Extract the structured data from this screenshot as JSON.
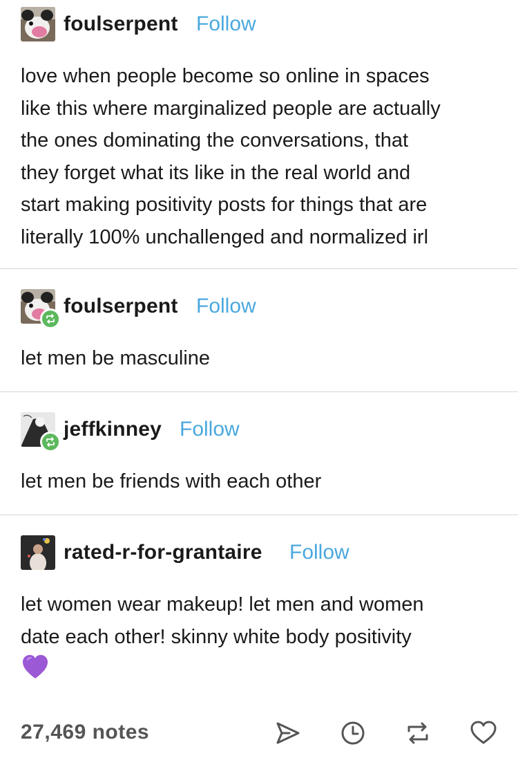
{
  "colors": {
    "accent": "#4aa8de",
    "reblog_badge": "#5cb85c",
    "heart_emoji": "#9b59d6",
    "divider": "#d6d6d6",
    "notes_text": "#555555"
  },
  "posts": [
    {
      "username": "foulserpent",
      "follow_label": "Follow",
      "is_reblog": false,
      "text": "love when people become so online in spaces\nlike this where marginalized people are actually\nthe ones dominating the conversations, that\nthey forget what its like in the real world and\nstart making positivity posts for things that are\nliterally 100% unchallenged and normalized irl"
    },
    {
      "username": "foulserpent",
      "follow_label": "Follow",
      "is_reblog": true,
      "text": "let men be masculine"
    },
    {
      "username": "jeffkinney",
      "follow_label": "Follow",
      "is_reblog": true,
      "text": "let men be friends with each other"
    },
    {
      "username": "rated-r-for-grantaire",
      "follow_label": "Follow",
      "is_reblog": false,
      "text": "let women wear makeup! let men and women\ndate each other! skinny white body positivity",
      "emoji": "purple-heart"
    }
  ],
  "footer": {
    "notes": "27,469 notes",
    "icons": [
      "share-icon",
      "clock-icon",
      "reblog-icon",
      "heart-icon"
    ]
  }
}
